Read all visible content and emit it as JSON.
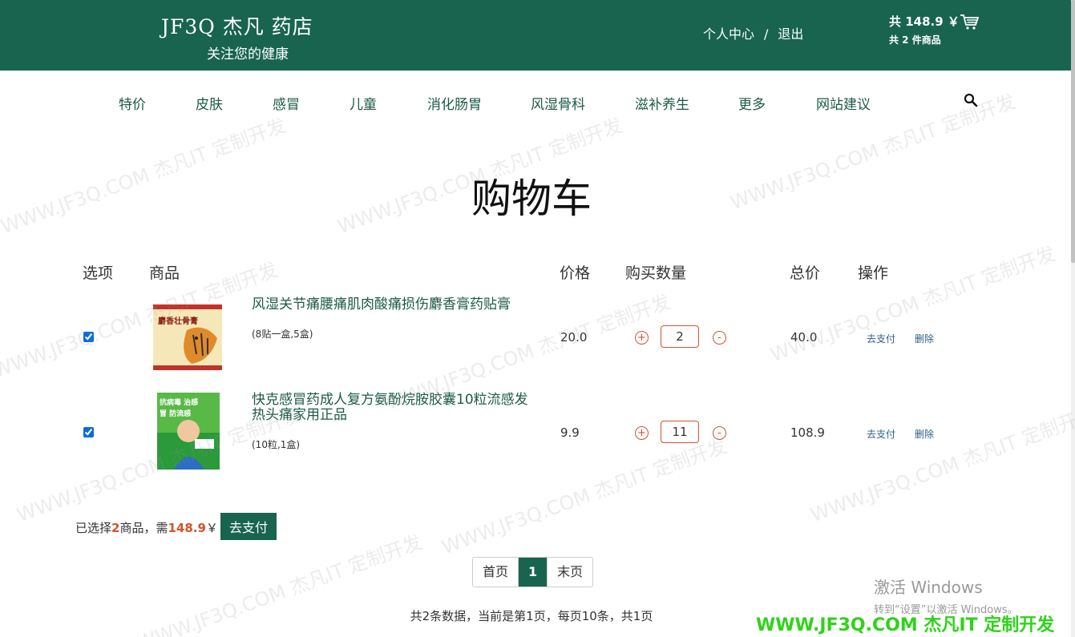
{
  "header": {
    "brand": "JF3Q 杰凡 药店",
    "slogan": "关注您的健康",
    "user_center": "个人中心",
    "separator": "/",
    "logout": "退出",
    "cart_total": "共 148.9 ￥",
    "cart_count": "共 2 件商品",
    "cart_icon": "cart-icon"
  },
  "nav": {
    "items": [
      "特价",
      "皮肤",
      "感冒",
      "儿童",
      "消化肠胃",
      "风湿骨科",
      "滋补养生",
      "更多",
      "网站建议"
    ],
    "search_icon": "search-icon"
  },
  "page_title": "购物车",
  "table": {
    "headers": [
      "选项",
      "商品",
      "价格",
      "购买数量",
      "总价",
      "操作"
    ],
    "rows": [
      {
        "checked": true,
        "name": "风湿关节痛腰痛肌肉酸痛损伤麝香膏药贴膏",
        "spec": "(8贴一盒,5盒)",
        "price": "20.0",
        "qty": "2",
        "total": "40.0",
        "pay": "去支付",
        "delete": "删除",
        "image_text": "麝香壮骨膏"
      },
      {
        "checked": true,
        "name": "快克感冒药成人复方氨酚烷胺胶囊10粒流感发热头痛家用正品",
        "spec": "(10粒,1盒)",
        "price": "9.9",
        "qty": "11",
        "total": "108.9",
        "pay": "去支付",
        "delete": "删除",
        "image_text": "抗病毒 治感冒 防流感"
      }
    ],
    "plus": "+",
    "minus": "-"
  },
  "summary": {
    "prefix": "已选择",
    "count": "2",
    "middle": "商品，需",
    "amount": "148.9",
    "suffix": "￥",
    "pay_button": "去支付"
  },
  "pager": {
    "first": "首页",
    "current": "1",
    "last": "末页",
    "info": "共2条数据，当前是第1页，每页10条，共1页"
  },
  "os": {
    "activate_title": "激活 Windows",
    "activate_hint": "转到“设置”以激活 Windows。"
  },
  "watermark": {
    "corner": "WWW.JF3Q.COM 杰凡IT  定制开发",
    "text": "WWW.JF3Q.COM 杰凡IT  定制开发"
  },
  "colors": {
    "brand_green": "#18644f",
    "accent_orange": "#d5522b",
    "watermark_green": "#2fd319"
  }
}
